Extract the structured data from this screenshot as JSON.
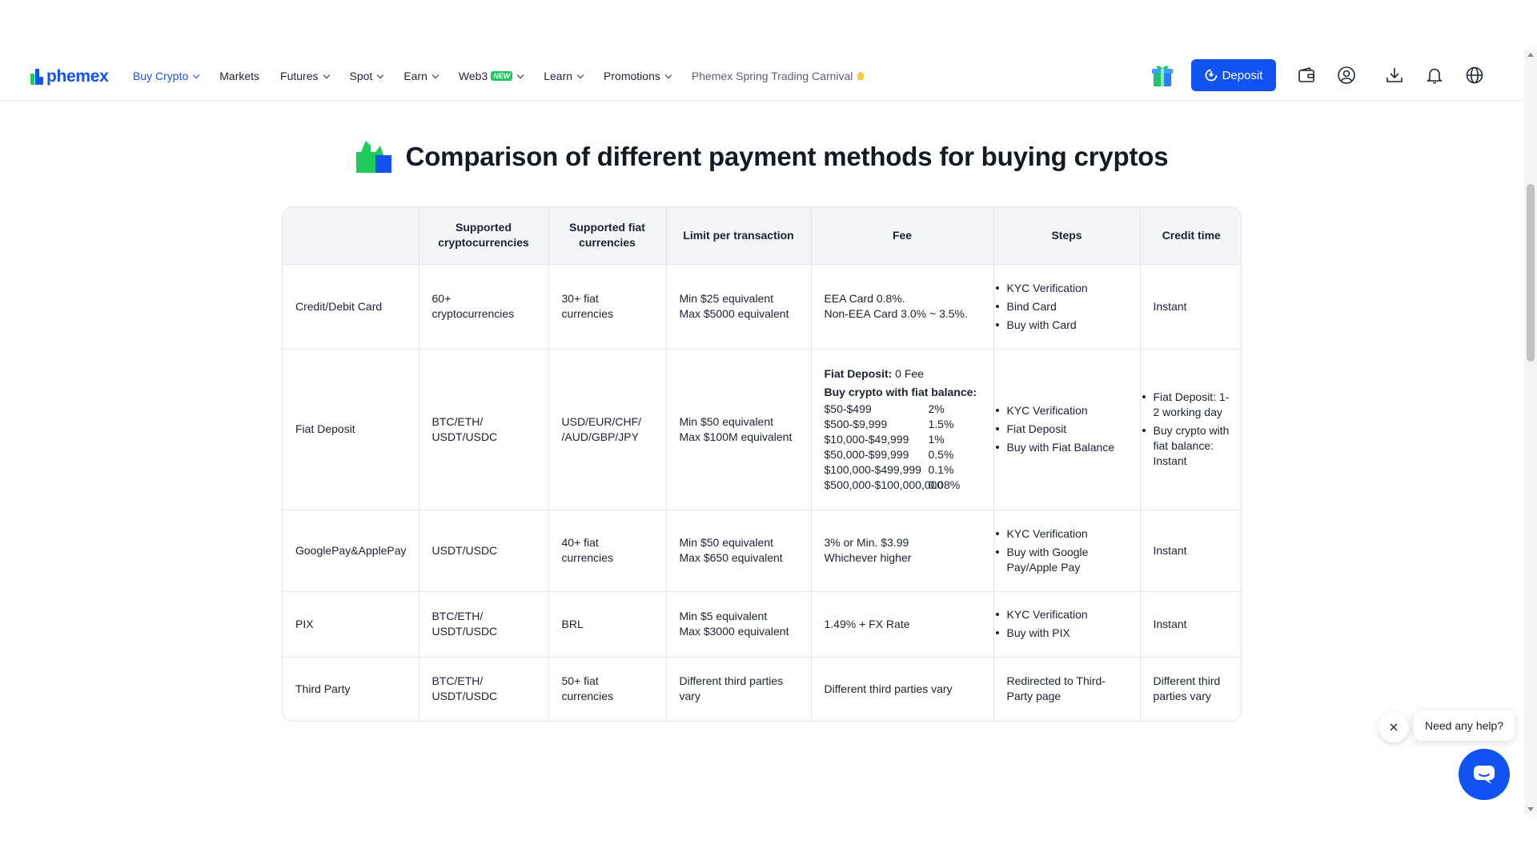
{
  "header": {
    "logo_text": "phemex",
    "nav": [
      {
        "label": "Buy Crypto",
        "dropdown": true,
        "active": true
      },
      {
        "label": "Markets",
        "dropdown": false
      },
      {
        "label": "Futures",
        "dropdown": true
      },
      {
        "label": "Spot",
        "dropdown": true
      },
      {
        "label": "Earn",
        "dropdown": true
      },
      {
        "label": "Web3",
        "dropdown": true,
        "badge": "NEW"
      },
      {
        "label": "Learn",
        "dropdown": true
      },
      {
        "label": "Promotions",
        "dropdown": true
      },
      {
        "label": "Phemex Spring Trading Carnival"
      }
    ],
    "deposit_label": "Deposit",
    "icons": [
      "gift-icon",
      "wallet-icon",
      "user-icon",
      "download-icon",
      "bell-icon",
      "globe-icon"
    ]
  },
  "title": "Comparison of different payment methods for buying cryptos",
  "table": {
    "headers": [
      "",
      "Supported cryptocurrencies",
      "Supported fiat currencies",
      "Limit per transaction",
      "Fee",
      "Steps",
      "Credit time"
    ],
    "rows": [
      {
        "method": "Credit/Debit Card",
        "crypto": "60+ cryptocurrencies",
        "fiat": "30+ fiat currencies",
        "limit": [
          "Min $25 equivalent",
          "Max $5000 equivalent"
        ],
        "fee": [
          "EEA Card 0.8%.",
          "Non-EEA Card 3.0% ~ 3.5%."
        ],
        "steps": [
          "KYC Verification",
          "Bind Card",
          "Buy with Card"
        ],
        "credit": "Instant"
      },
      {
        "method": "Fiat Deposit",
        "crypto": "BTC/ETH/ USDT/USDC",
        "fiat": "USD/EUR/CHF/ /AUD/GBP/JPY",
        "limit": [
          "Min $50 equivalent",
          "Max $100M equivalent"
        ],
        "fee_fiat_label": "Fiat Deposit:",
        "fee_fiat_value": " 0 Fee",
        "fee_buy_label": "Buy crypto with fiat balance:",
        "fee_tiers": [
          {
            "range": "$50-$499",
            "rate": "2%"
          },
          {
            "range": "$500-$9,999",
            "rate": "1.5%"
          },
          {
            "range": "$10,000-$49,999",
            "rate": "1%"
          },
          {
            "range": "$50,000-$99,999",
            "rate": "0.5%"
          },
          {
            "range": "$100,000-$499,999",
            "rate": "0.1%"
          },
          {
            "range": "$500,000-$100,000,000",
            "rate": "0.08%"
          }
        ],
        "steps": [
          "KYC Verification",
          "Fiat Deposit",
          "Buy with Fiat Balance"
        ],
        "credit_list": [
          "Fiat Deposit: 1-2 working day",
          "Buy crypto with fiat balance: Instant"
        ]
      },
      {
        "method": "GooglePay&ApplePay",
        "crypto": "USDT/USDC",
        "fiat": "40+ fiat currencies",
        "limit": [
          "Min $50 equivalent",
          "Max $650 equivalent"
        ],
        "fee": [
          "3% or Min. $3.99",
          "Whichever higher"
        ],
        "steps": [
          "KYC Verification",
          "Buy with Google Pay/Apple Pay"
        ],
        "credit": "Instant"
      },
      {
        "method": "PIX",
        "crypto": "BTC/ETH/ USDT/USDC",
        "fiat": "BRL",
        "limit": [
          "Min $5 equivalent",
          "Max $3000 equivalent"
        ],
        "fee": [
          "1.49% + FX Rate"
        ],
        "steps": [
          "KYC Verification",
          "Buy with PIX"
        ],
        "credit": "Instant"
      },
      {
        "method": "Third Party",
        "crypto": "BTC/ETH/ USDT/USDC",
        "fiat": "50+ fiat currencies",
        "limit": [
          "Different third parties vary"
        ],
        "fee": [
          "Different third parties vary"
        ],
        "steps_text": "Redirected to Third-Party page",
        "credit": "Different third parties vary"
      }
    ]
  },
  "help_widget": {
    "message": "Need any help?"
  },
  "colors": {
    "brand": "#1152f2",
    "green": "#1ecb5a"
  }
}
